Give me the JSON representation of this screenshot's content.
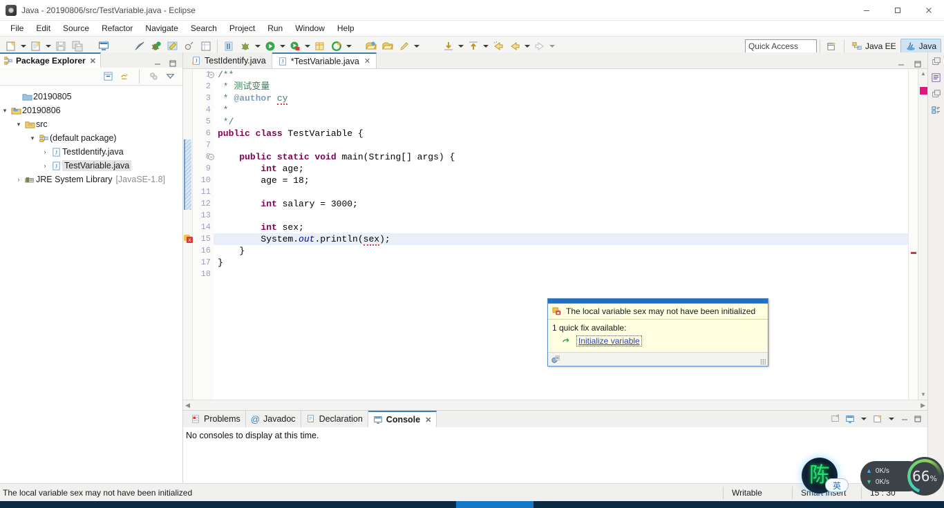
{
  "window": {
    "title": "Java - 20190806/src/TestVariable.java - Eclipse",
    "minimize": "minimize-button",
    "maximize": "maximize-button",
    "close": "close-button"
  },
  "menubar": {
    "items": [
      "File",
      "Edit",
      "Source",
      "Refactor",
      "Navigate",
      "Search",
      "Project",
      "Run",
      "Window",
      "Help"
    ]
  },
  "toolbar": {
    "quick_access_placeholder": "Quick Access",
    "perspectives": [
      {
        "label": "Java EE",
        "active": false
      },
      {
        "label": "Java",
        "active": true
      }
    ]
  },
  "explorer": {
    "tab_label": "Package Explorer",
    "tab_close": "✕",
    "tree": [
      {
        "indent": 0,
        "twisty": "",
        "icon": "folder-icon",
        "label": "20190805",
        "dim": "",
        "selected": false
      },
      {
        "indent": 0,
        "twisty": "▾",
        "icon": "project-icon",
        "label": "20190806",
        "dim": "",
        "selected": false
      },
      {
        "indent": 1,
        "twisty": "▾",
        "icon": "source-folder-icon",
        "label": "src",
        "dim": "",
        "selected": false
      },
      {
        "indent": 2,
        "twisty": "▾",
        "icon": "package-icon",
        "label": "(default package)",
        "dim": "",
        "selected": false
      },
      {
        "indent": 3,
        "twisty": "›",
        "icon": "java-file-icon",
        "label": "TestIdentify.java",
        "dim": "",
        "selected": false
      },
      {
        "indent": 3,
        "twisty": "›",
        "icon": "java-file-icon",
        "label": "TestVariable.java",
        "dim": "",
        "selected": true
      },
      {
        "indent": 1,
        "twisty": "›",
        "icon": "library-icon",
        "label": "JRE System Library",
        "dim": "[JavaSE-1.8]",
        "selected": false
      }
    ]
  },
  "editor": {
    "tabs": [
      {
        "label": "TestIdentify.java",
        "active": false,
        "dirty": false,
        "closable": false
      },
      {
        "label": "*TestVariable.java",
        "active": true,
        "dirty": true,
        "closable": true
      }
    ],
    "tab_close": "✕",
    "lines": [
      {
        "n": "1",
        "fold": true,
        "text": "/**"
      },
      {
        "n": "2",
        "fold": false,
        "text": " * 测试变量"
      },
      {
        "n": "3",
        "fold": false,
        "text": " * @author cy"
      },
      {
        "n": "4",
        "fold": false,
        "text": " *"
      },
      {
        "n": "5",
        "fold": false,
        "text": " */"
      },
      {
        "n": "6",
        "fold": false,
        "text": "public class TestVariable {"
      },
      {
        "n": "7",
        "fold": false,
        "text": ""
      },
      {
        "n": "8",
        "fold": true,
        "text": "    public static void main(String[] args) {"
      },
      {
        "n": "9",
        "fold": false,
        "text": "        int age;"
      },
      {
        "n": "10",
        "fold": false,
        "text": "        age = 18;"
      },
      {
        "n": "11",
        "fold": false,
        "text": ""
      },
      {
        "n": "12",
        "fold": false,
        "text": "        int salary = 3000;"
      },
      {
        "n": "13",
        "fold": false,
        "text": ""
      },
      {
        "n": "14",
        "fold": false,
        "text": "        int sex;"
      },
      {
        "n": "15",
        "fold": false,
        "text": "        System.out.println(sex);"
      },
      {
        "n": "16",
        "fold": false,
        "text": "    }"
      },
      {
        "n": "17",
        "fold": false,
        "text": "}"
      },
      {
        "n": "18",
        "fold": false,
        "text": ""
      }
    ]
  },
  "quickfix": {
    "message": "The local variable sex may not have been initialized",
    "count_label": "1 quick fix available:",
    "fix_label": "Initialize variable"
  },
  "bottom_view": {
    "tabs": [
      {
        "label": "Problems",
        "active": false
      },
      {
        "label": "Javadoc",
        "active": false
      },
      {
        "label": "Declaration",
        "active": false
      },
      {
        "label": "Console",
        "active": true
      }
    ],
    "tab_close": "✕",
    "content": "No consoles to display at this time."
  },
  "statusbar": {
    "message": "The local variable sex may not have been initialized",
    "writable": "Writable",
    "insert_mode": "Smart Insert",
    "position": "15 : 30"
  },
  "overlays": {
    "ime_char": "陈",
    "ime_lang": "英",
    "net_up": "0K/s",
    "net_down": "0K/s",
    "cpu_value": "66",
    "cpu_unit": "%"
  },
  "colors": {
    "accent": "#3c7fb1",
    "keyword": "#7f0055",
    "comment": "#3f7f5f",
    "javadoc_tag": "#7f9fbf",
    "static_field": "#0000c0",
    "error": "#d43c3c",
    "selection": "#e8eff9",
    "popup_bg": "#ffffe1",
    "popup_border": "#5a8fc0"
  }
}
